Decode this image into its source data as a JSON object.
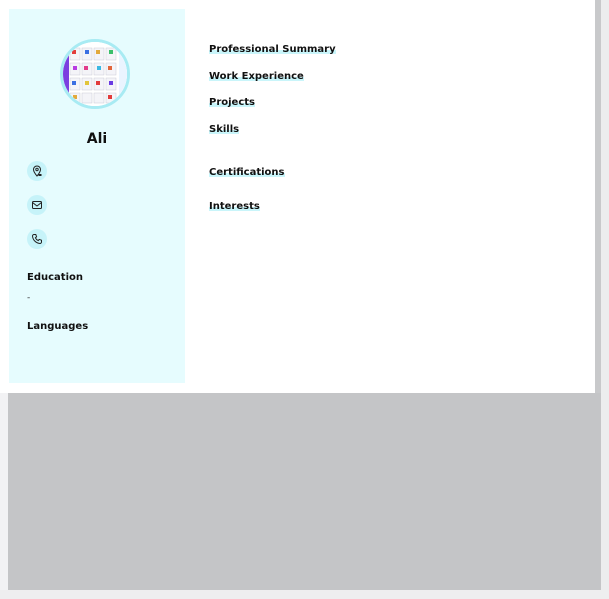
{
  "profile": {
    "name": "Ali"
  },
  "sidebar": {
    "contacts": [
      {
        "icon": "location-pin-icon"
      },
      {
        "icon": "mail-icon"
      },
      {
        "icon": "phone-icon"
      }
    ],
    "education": {
      "title": "Education",
      "value": "-"
    },
    "languages": {
      "title": "Languages"
    }
  },
  "sections": [
    {
      "label": "Professional Summary"
    },
    {
      "label": "Work Experience"
    },
    {
      "label": "Projects"
    },
    {
      "label": "Skills"
    },
    {
      "label": "Certifications"
    },
    {
      "label": "Interests"
    }
  ],
  "colors": {
    "sidebar_bg": "#e6fcfe",
    "accent": "#a8ebf3",
    "highlight": "#c9f5fa"
  }
}
